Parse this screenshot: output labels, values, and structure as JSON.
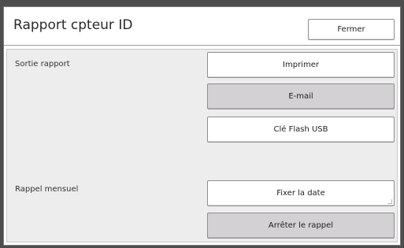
{
  "dialog": {
    "title": "Rapport cpteur ID",
    "close_label": "Fermer"
  },
  "report_output": {
    "label": "Sortie rapport",
    "buttons": [
      {
        "label": "Imprimer",
        "state": "normal"
      },
      {
        "label": "E-mail",
        "state": "selected"
      },
      {
        "label": "Clé Flash USB",
        "state": "normal"
      }
    ]
  },
  "monthly_reminder": {
    "label": "Rappel mensuel",
    "buttons": [
      {
        "label": "Fixer la date",
        "state": "normal"
      },
      {
        "label": "Arrêter le rappel",
        "state": "selected"
      }
    ]
  },
  "colors": {
    "background": "#4d4d4d",
    "panel": "#ededed",
    "button_normal": "#ffffff",
    "button_selected": "#d3d1d3",
    "border": "#8e8e8e"
  }
}
